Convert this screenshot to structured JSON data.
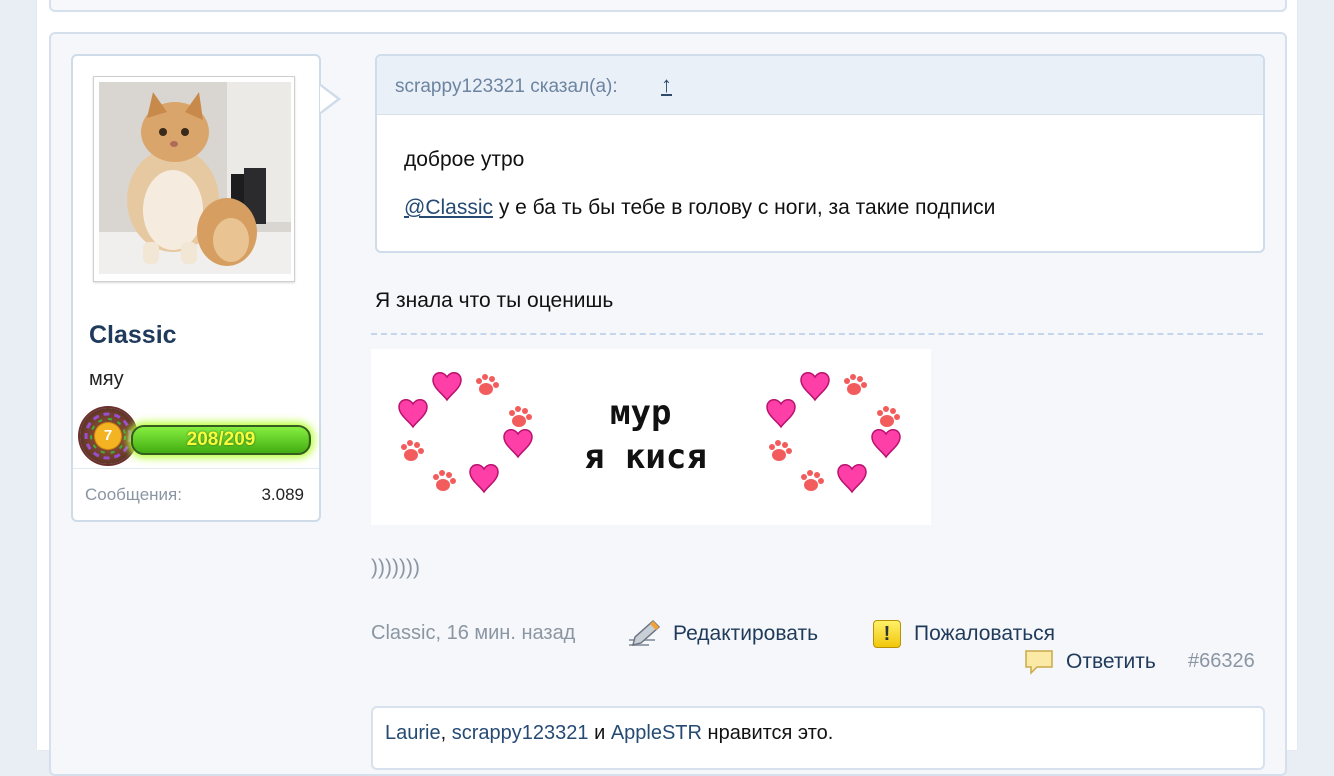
{
  "post": {
    "user": {
      "username": "Classic",
      "title": "мяу",
      "level": "7",
      "xp_text": "208/209",
      "xp_fraction": 0.995,
      "stats": {
        "messages_label": "Сообщения:",
        "messages_value": "3.089"
      }
    },
    "quote": {
      "author": "scrappy123321 сказал(а):",
      "jump_arrow": "↑",
      "line1": "доброе утро",
      "mention": "@Classic",
      "line2_rest": " у е ба ть бы тебе в голову с ноги, за такие подписи"
    },
    "message": "Я знала что ты оценишь",
    "signature": {
      "line1": "мур",
      "line2": "я кися"
    },
    "smile": ")))))))",
    "meta": {
      "author_time": "Classic, 16 мин. назад",
      "edit_label": "Редактировать",
      "report_label": "Пожаловаться",
      "reply_label": "Ответить",
      "post_number": "#66326"
    },
    "likes": {
      "user1": "Laurie",
      "sep1": ", ",
      "user2": "scrappy123321",
      "and": " и ",
      "user3": "AppleSTR",
      "suffix": " нравится это."
    }
  },
  "colors": {
    "accent": "#1f3a5a",
    "link": "#254a74",
    "muted": "#8b96a3",
    "border": "#d5e0ec"
  },
  "icons": [
    "pencil-icon",
    "exclamation-icon",
    "speech-bubble-icon",
    "heart-icon",
    "paw-icon"
  ]
}
